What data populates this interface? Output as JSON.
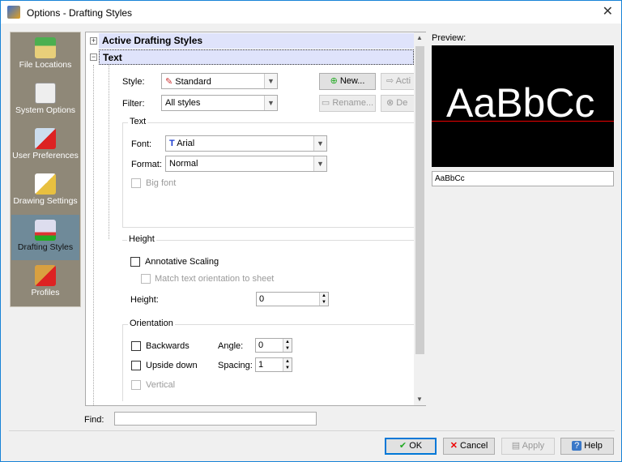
{
  "window": {
    "title": "Options - Drafting Styles",
    "close_icon": "close-icon"
  },
  "nav": {
    "items": [
      {
        "label": "File Locations",
        "icon": "folder-arrow-icon",
        "selected": false
      },
      {
        "label": "System Options",
        "icon": "checklist-icon",
        "selected": false
      },
      {
        "label": "User Preferences",
        "icon": "user-preferences-icon",
        "selected": false
      },
      {
        "label": "Drawing Settings",
        "icon": "drawing-settings-icon",
        "selected": false
      },
      {
        "label": "Drafting Styles",
        "icon": "drafting-styles-icon",
        "selected": true
      },
      {
        "label": "Profiles",
        "icon": "profiles-icon",
        "selected": false
      }
    ]
  },
  "tree": {
    "active_drafting_styles": "Active Drafting Styles",
    "text": "Text"
  },
  "style": {
    "label": "Style:",
    "value": "Standard",
    "filter_label": "Filter:",
    "filter_value": "All styles",
    "new": "New...",
    "activate": "Acti",
    "rename": "Rename...",
    "delete": "De"
  },
  "text_group": {
    "title": "Text",
    "font_label": "Font:",
    "font_value": "Arial",
    "format_label": "Format:",
    "format_value": "Normal",
    "big_font": "Big font"
  },
  "height_group": {
    "title": "Height",
    "annotative": "Annotative Scaling",
    "match": "Match text orientation to sheet",
    "height_label": "Height:",
    "height_value": "0"
  },
  "orientation_group": {
    "title": "Orientation",
    "backwards": "Backwards",
    "upside_down": "Upside down",
    "vertical": "Vertical",
    "angle_label": "Angle:",
    "angle_value": "0",
    "spacing_label": "Spacing:",
    "spacing_value": "1"
  },
  "preview": {
    "label": "Preview:",
    "sample": "AaBbCc",
    "field_value": "AaBbCc"
  },
  "find": {
    "label": "Find:",
    "value": ""
  },
  "buttons": {
    "ok": "OK",
    "cancel": "Cancel",
    "apply": "Apply",
    "help": "Help"
  }
}
